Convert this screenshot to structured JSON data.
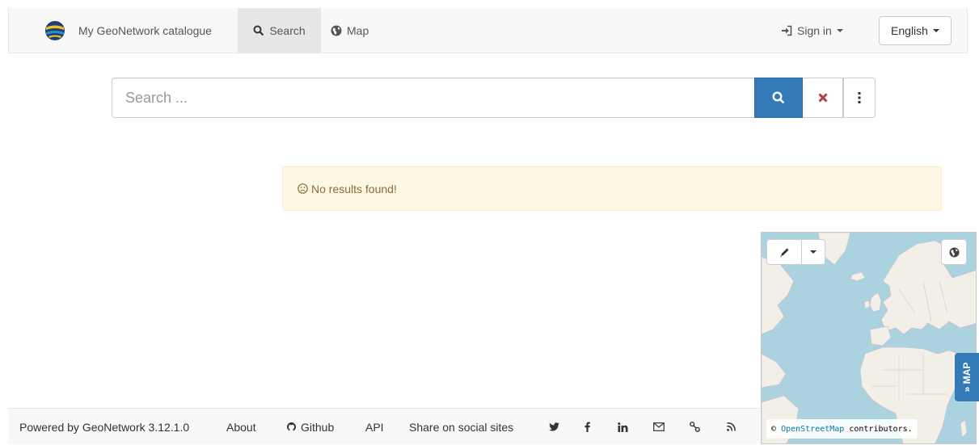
{
  "navbar": {
    "brand": "My GeoNetwork catalogue",
    "items": [
      {
        "label": "Search",
        "icon": "search-icon",
        "active": true
      },
      {
        "label": "Map",
        "icon": "globe-icon",
        "active": false
      }
    ],
    "sign_in": "Sign in",
    "language": "English"
  },
  "search": {
    "placeholder": "Search ...",
    "value": ""
  },
  "results": {
    "message": "No results found!"
  },
  "map": {
    "attribution_prefix": "©",
    "attribution_link": "OpenStreetMap",
    "attribution_suffix": "contributors.",
    "toggle_label": "» MAP"
  },
  "footer": {
    "powered_by": "Powered by GeoNetwork 3.12.1.0",
    "links": [
      "About",
      "Github",
      "API",
      "Share on social sites"
    ],
    "social_icons": [
      "twitter-icon",
      "facebook-icon",
      "linkedin-icon",
      "email-icon",
      "link-icon",
      "rss-icon"
    ]
  },
  "colors": {
    "primary": "#337ab7",
    "warning_bg": "#fcf8e3",
    "warning_text": "#8a6d3b",
    "clear": "#a94442",
    "water": "#aad3df",
    "land": "#f2efe9"
  }
}
